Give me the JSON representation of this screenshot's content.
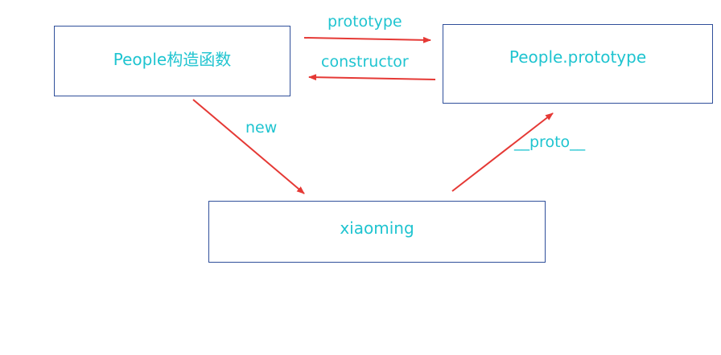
{
  "nodes": {
    "people_constructor": "People构造函数",
    "people_prototype": "People.prototype",
    "xiaoming": "xiaoming"
  },
  "edges": {
    "prototype": "prototype",
    "constructor": "constructor",
    "new": "new",
    "proto": "__proto__"
  },
  "colors": {
    "text": "#1fc4d0",
    "box_border": "#2f4f9a",
    "arrow": "#e53935"
  }
}
